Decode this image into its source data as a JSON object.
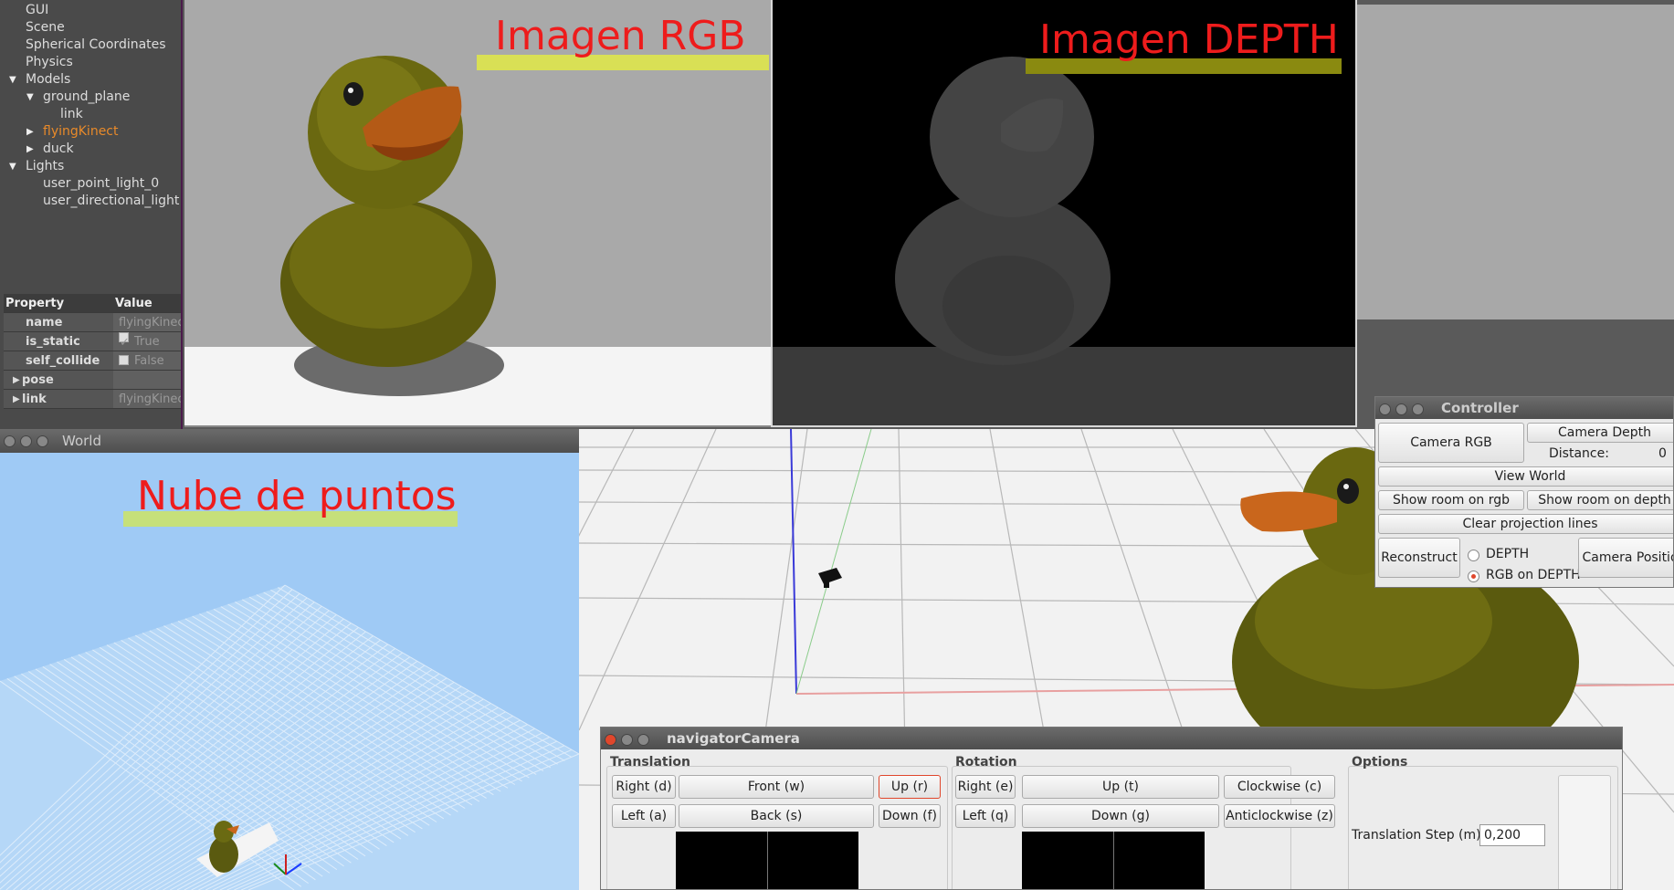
{
  "tree": {
    "items": [
      {
        "label": "GUI",
        "indent": 0,
        "arrow": ""
      },
      {
        "label": "Scene",
        "indent": 0,
        "arrow": ""
      },
      {
        "label": "Spherical Coordinates",
        "indent": 0,
        "arrow": ""
      },
      {
        "label": "Physics",
        "indent": 0,
        "arrow": ""
      },
      {
        "label": "Models",
        "indent": 0,
        "arrow": "down"
      },
      {
        "label": "ground_plane",
        "indent": 1,
        "arrow": "down"
      },
      {
        "label": "link",
        "indent": 2,
        "arrow": ""
      },
      {
        "label": "flyingKinect",
        "indent": 1,
        "arrow": "right",
        "selected": true
      },
      {
        "label": "duck",
        "indent": 1,
        "arrow": "right"
      },
      {
        "label": "Lights",
        "indent": 0,
        "arrow": "down"
      },
      {
        "label": "user_point_light_0",
        "indent": 1,
        "arrow": ""
      },
      {
        "label": "user_directional_light",
        "indent": 1,
        "arrow": ""
      }
    ],
    "selected_color": "#e88a2a"
  },
  "properties": {
    "header_property": "Property",
    "header_value": "Value",
    "name_key": "name",
    "name_value": "flyingKinect",
    "is_static_key": "is_static",
    "is_static_value": "True",
    "self_collide_key": "self_collide",
    "self_collide_value": "False",
    "pose_key": "pose",
    "link_key": "link",
    "link_value": "flyingKinect::"
  },
  "rgb_view": {
    "title": "Imagen RGB",
    "bar_color": "#d9e055"
  },
  "depth_view": {
    "title": "Imagen DEPTH",
    "bar_color": "#8a8a10"
  },
  "world_window": {
    "title": "World",
    "overlay_title": "Nube de puntos",
    "bar_color": "#c6e07a"
  },
  "controller": {
    "title": "Controller",
    "camera_rgb": "Camera RGB",
    "camera_depth": "Camera Depth",
    "distance_label": "Distance:",
    "distance_value": "0",
    "view_world": "View World",
    "show_room_rgb": "Show room on rgb",
    "show_room_depth": "Show room on depth",
    "clear_projection": "Clear projection lines",
    "reconstruct": "Reconstruct",
    "radio_depth": "DEPTH",
    "radio_rgb_on_depth": "RGB on DEPTH",
    "camera_position": "Camera Positio"
  },
  "navcam": {
    "title": "navigatorCamera",
    "translation_title": "Translation",
    "rotation_title": "Rotation",
    "options_title": "Options",
    "t_right": "Right (d)",
    "t_front": "Front (w)",
    "t_up": "Up (r)",
    "t_left": "Left (a)",
    "t_back": "Back (s)",
    "t_down": "Down (f)",
    "r_right": "Right (e)",
    "r_up": "Up (t)",
    "r_clockwise": "Clockwise (c)",
    "r_left": "Left (q)",
    "r_down": "Down (g)",
    "r_anticlockwise": "Anticlockwise (z)",
    "translation_step_label": "Translation Step (m)",
    "translation_step_value": "0,200"
  },
  "colors": {
    "title_red": "#ee1c1c",
    "duck_yellow": "#7a7a10",
    "beak_orange": "#c9661c"
  }
}
